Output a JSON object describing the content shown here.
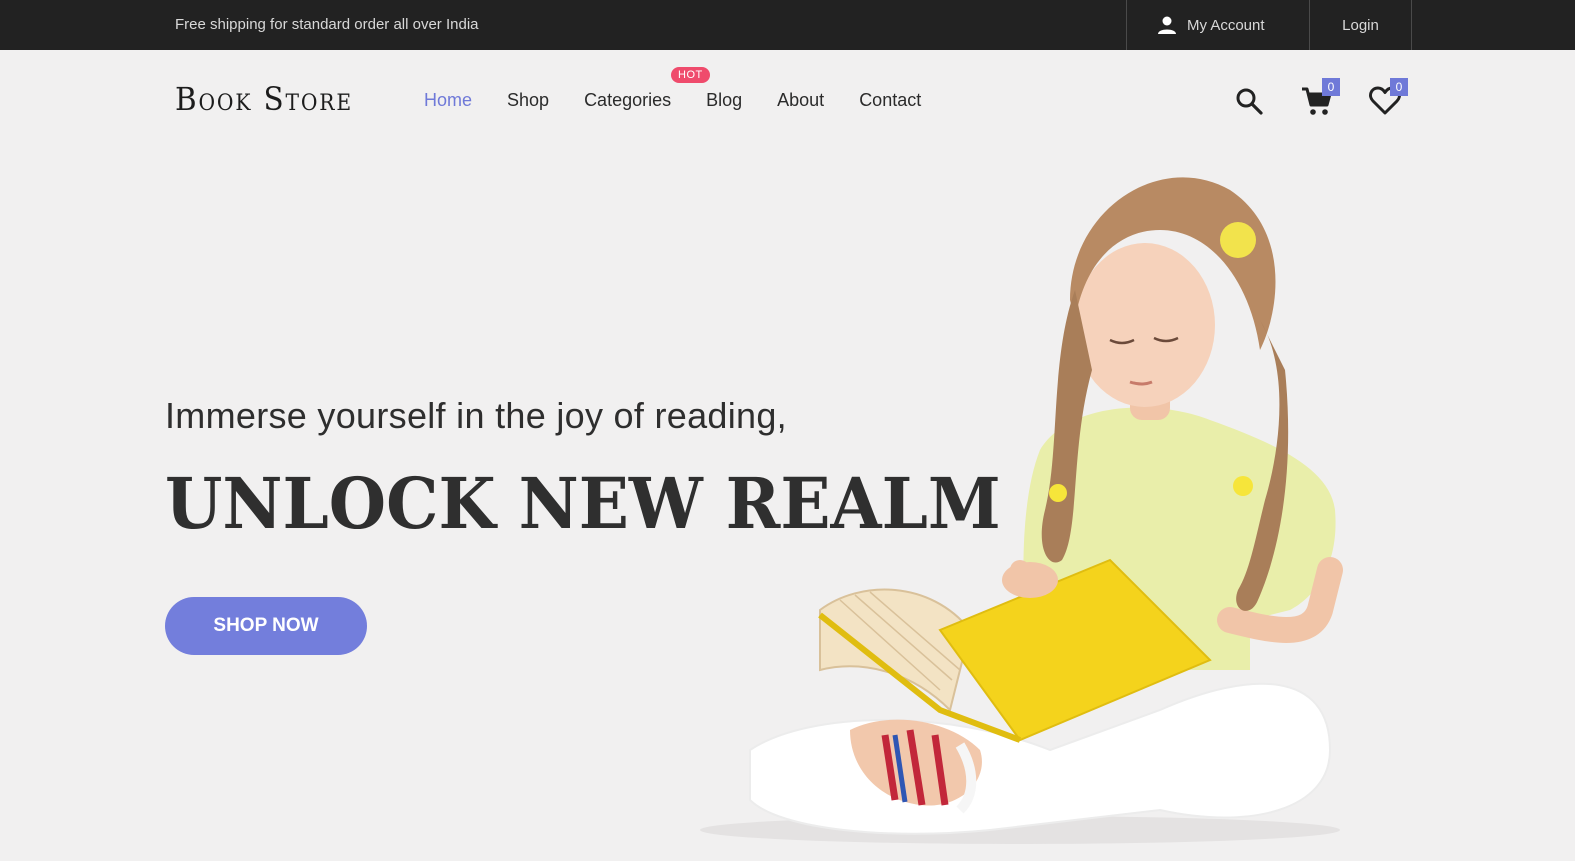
{
  "topbar": {
    "shipping_text": "Free shipping for standard order all over India",
    "account_label": "My Account",
    "login_label": "Login"
  },
  "header": {
    "logo_text": "Book Store",
    "nav": [
      {
        "label": "Home",
        "active": true
      },
      {
        "label": "Shop",
        "active": false
      },
      {
        "label": "Categories",
        "active": false
      },
      {
        "label": "Blog",
        "active": false
      },
      {
        "label": "About",
        "active": false
      },
      {
        "label": "Contact",
        "active": false
      }
    ],
    "categories_badge": "HOT",
    "cart_count": "0",
    "wishlist_count": "0",
    "icons": [
      "search-icon",
      "cart-icon",
      "heart-icon"
    ]
  },
  "hero": {
    "subtitle": "Immerse yourself in the joy of reading,",
    "headline": "UNLOCK NEW REALM",
    "cta_label": "SHOP NOW",
    "image_subject": "child-reading-book"
  },
  "colors": {
    "accent": "#737edc",
    "topbar_bg": "#222222",
    "page_bg": "#f1f0f0",
    "hot_badge": "#ef4b6c"
  }
}
